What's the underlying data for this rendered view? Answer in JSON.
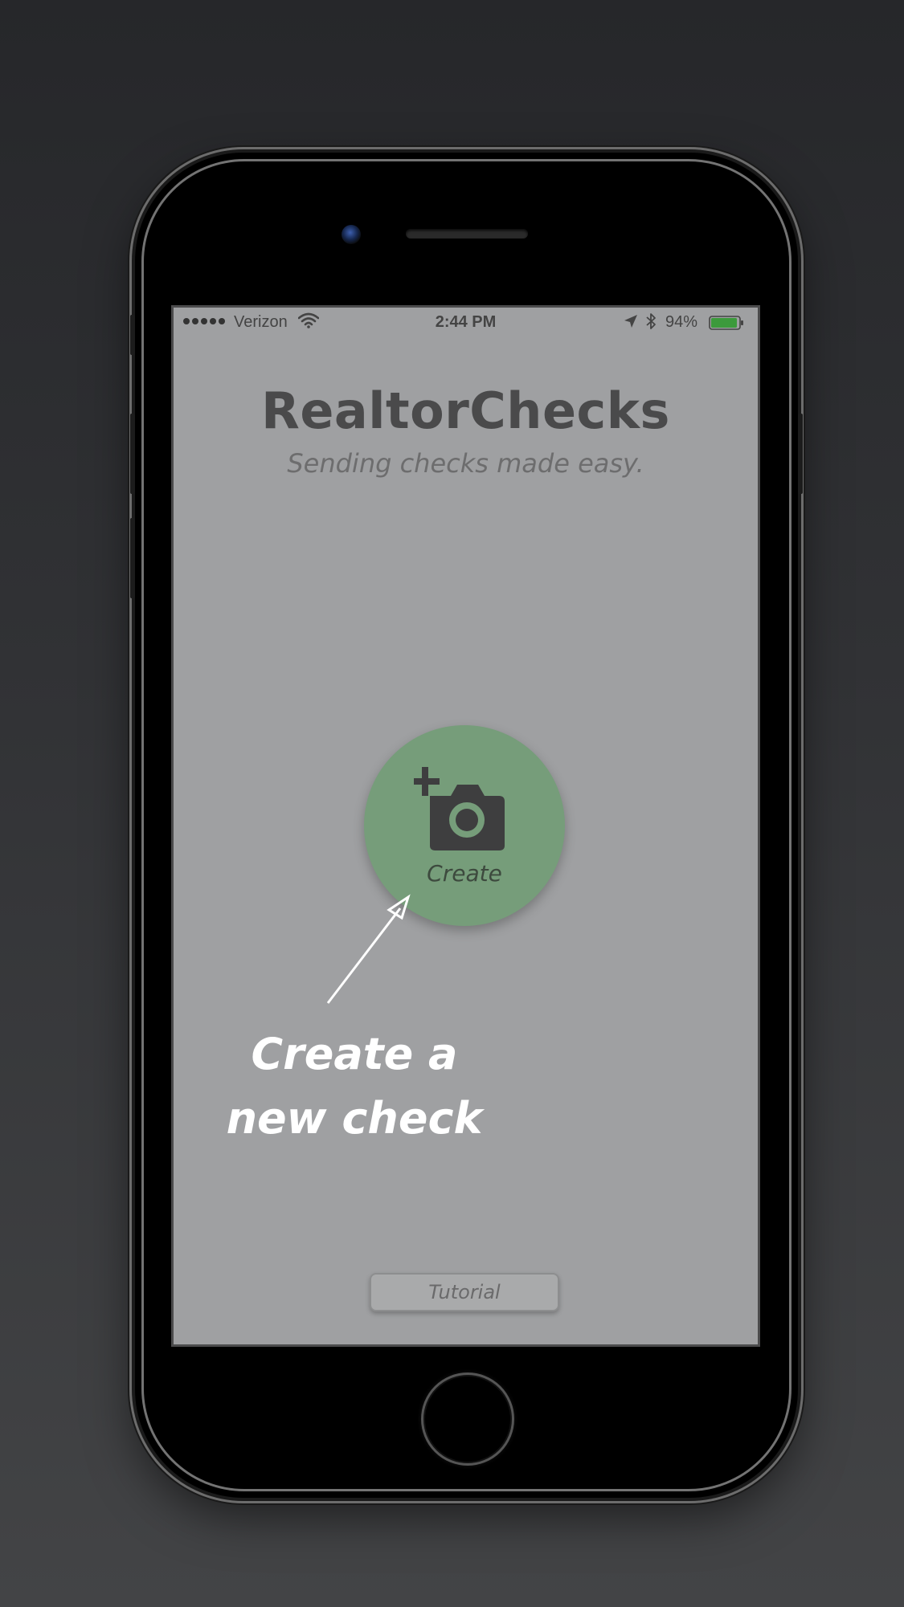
{
  "status_bar": {
    "carrier": "Verizon",
    "time": "2:44 PM",
    "battery_percent": "94%",
    "battery_level": 0.94,
    "battery_color": "#3c9a3c",
    "signal_icon": "signal-dots-icon",
    "wifi_icon": "wifi-icon",
    "location_icon": "location-arrow-icon",
    "bluetooth_icon": "bluetooth-icon"
  },
  "app": {
    "title": "RealtorChecks",
    "subtitle": "Sending checks made easy."
  },
  "create": {
    "label": "Create",
    "icon": "camera-add-icon",
    "color": "#769d7a"
  },
  "hint": {
    "text": "Create a new check",
    "arrow_icon": "arrow-icon"
  },
  "tutorial": {
    "label": "Tutorial"
  }
}
